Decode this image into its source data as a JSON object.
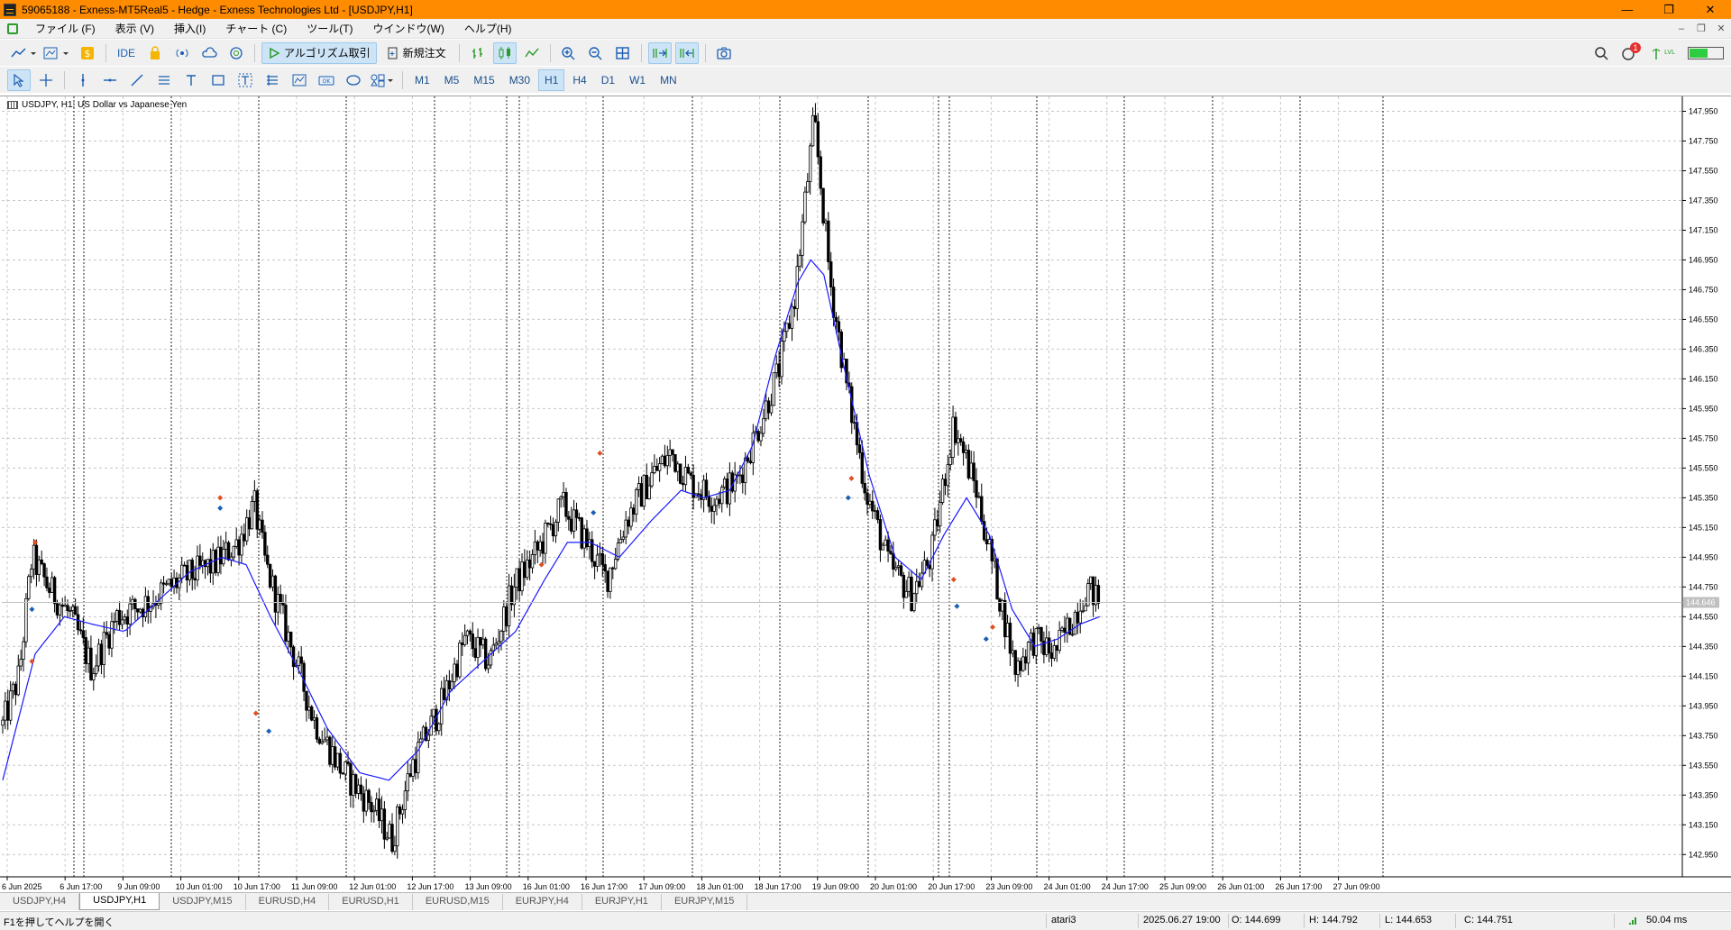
{
  "window": {
    "title": "59065188 - Exness-MT5Real5 - Hedge - Exness Technologies Ltd - [USDJPY,H1]"
  },
  "menu": [
    {
      "label": "ファイル (F)"
    },
    {
      "label": "表示 (V)"
    },
    {
      "label": "挿入(I)"
    },
    {
      "label": "チャート (C)"
    },
    {
      "label": "ツール(T)"
    },
    {
      "label": "ウインドウ(W)"
    },
    {
      "label": "ヘルプ(H)"
    }
  ],
  "toolbar": {
    "ide_label": "IDE",
    "algo_label": "アルゴリズム取引",
    "neworder_label": "新規注文",
    "notification_count": "1",
    "signal_label": "LVL"
  },
  "timeframes": [
    "M1",
    "M5",
    "M15",
    "M30",
    "H1",
    "H4",
    "D1",
    "W1",
    "MN"
  ],
  "active_timeframe": "H1",
  "chart": {
    "symbol_label": "USDJPY, H1:  US Dollar vs Japanese Yen",
    "current_price_label": "144.646"
  },
  "chart_data": {
    "type": "candlestick",
    "symbol": "USDJPY",
    "timeframe": "H1",
    "ylim": [
      142.8,
      148.05
    ],
    "yticks": [
      "147.950",
      "147.750",
      "147.550",
      "147.350",
      "147.150",
      "146.950",
      "146.750",
      "146.550",
      "146.350",
      "146.150",
      "145.950",
      "145.750",
      "145.550",
      "145.350",
      "145.150",
      "144.950",
      "144.750",
      "144.550",
      "144.350",
      "144.150",
      "143.950",
      "143.750",
      "143.550",
      "143.350",
      "143.150",
      "142.950"
    ],
    "xticks": [
      "6 Jun 2025",
      "6 Jun 17:00",
      "9 Jun 09:00",
      "10 Jun 01:00",
      "10 Jun 17:00",
      "11 Jun 09:00",
      "12 Jun 01:00",
      "12 Jun 17:00",
      "13 Jun 09:00",
      "16 Jun 01:00",
      "16 Jun 17:00",
      "17 Jun 09:00",
      "18 Jun 01:00",
      "18 Jun 17:00",
      "19 Jun 09:00",
      "20 Jun 01:00",
      "20 Jun 17:00",
      "23 Jun 09:00",
      "24 Jun 01:00",
      "24 Jun 17:00",
      "25 Jun 09:00",
      "26 Jun 01:00",
      "26 Jun 17:00",
      "27 Jun 09:00"
    ],
    "close_path": [
      [
        0,
        143.82
      ],
      [
        10,
        144.15
      ],
      [
        18,
        144.95
      ],
      [
        28,
        144.75
      ],
      [
        42,
        144.55
      ],
      [
        55,
        144.2
      ],
      [
        70,
        144.55
      ],
      [
        90,
        144.65
      ],
      [
        110,
        144.8
      ],
      [
        130,
        144.9
      ],
      [
        145,
        145.05
      ],
      [
        155,
        145.3
      ],
      [
        162,
        144.9
      ],
      [
        172,
        144.55
      ],
      [
        182,
        144.2
      ],
      [
        192,
        143.85
      ],
      [
        210,
        143.5
      ],
      [
        226,
        143.3
      ],
      [
        240,
        143.05
      ],
      [
        252,
        143.55
      ],
      [
        270,
        143.95
      ],
      [
        285,
        144.4
      ],
      [
        300,
        144.25
      ],
      [
        315,
        144.75
      ],
      [
        330,
        145.0
      ],
      [
        345,
        145.3
      ],
      [
        360,
        145.05
      ],
      [
        372,
        144.8
      ],
      [
        384,
        145.2
      ],
      [
        400,
        145.5
      ],
      [
        412,
        145.65
      ],
      [
        424,
        145.45
      ],
      [
        438,
        145.35
      ],
      [
        452,
        145.45
      ],
      [
        465,
        145.8
      ],
      [
        478,
        146.2
      ],
      [
        488,
        146.7
      ],
      [
        500,
        147.9
      ],
      [
        510,
        146.8
      ],
      [
        520,
        146.1
      ],
      [
        532,
        145.4
      ],
      [
        546,
        144.9
      ],
      [
        560,
        144.7
      ],
      [
        572,
        144.95
      ],
      [
        586,
        145.85
      ],
      [
        600,
        145.4
      ],
      [
        612,
        144.8
      ],
      [
        624,
        144.2
      ],
      [
        635,
        144.4
      ],
      [
        648,
        144.3
      ],
      [
        660,
        144.55
      ],
      [
        668,
        144.75
      ],
      [
        676,
        144.65
      ]
    ],
    "ma_path": [
      [
        0,
        143.45
      ],
      [
        20,
        144.3
      ],
      [
        38,
        144.55
      ],
      [
        55,
        144.5
      ],
      [
        75,
        144.45
      ],
      [
        95,
        144.65
      ],
      [
        115,
        144.85
      ],
      [
        135,
        144.95
      ],
      [
        150,
        144.9
      ],
      [
        165,
        144.55
      ],
      [
        182,
        144.2
      ],
      [
        200,
        143.8
      ],
      [
        220,
        143.5
      ],
      [
        238,
        143.45
      ],
      [
        256,
        143.65
      ],
      [
        276,
        144.05
      ],
      [
        296,
        144.25
      ],
      [
        316,
        144.45
      ],
      [
        334,
        144.8
      ],
      [
        348,
        145.05
      ],
      [
        362,
        145.05
      ],
      [
        380,
        144.95
      ],
      [
        400,
        145.2
      ],
      [
        418,
        145.4
      ],
      [
        432,
        145.35
      ],
      [
        448,
        145.4
      ],
      [
        462,
        145.7
      ],
      [
        476,
        146.3
      ],
      [
        490,
        146.8
      ],
      [
        498,
        146.95
      ],
      [
        506,
        146.85
      ],
      [
        518,
        146.25
      ],
      [
        534,
        145.5
      ],
      [
        550,
        144.95
      ],
      [
        566,
        144.8
      ],
      [
        580,
        145.1
      ],
      [
        594,
        145.35
      ],
      [
        608,
        145.1
      ],
      [
        622,
        144.6
      ],
      [
        636,
        144.35
      ],
      [
        650,
        144.4
      ],
      [
        664,
        144.5
      ],
      [
        676,
        144.55
      ]
    ]
  },
  "tabs": [
    {
      "label": "USDJPY,H4"
    },
    {
      "label": "USDJPY,H1"
    },
    {
      "label": "USDJPY,M15"
    },
    {
      "label": "EURUSD,H4"
    },
    {
      "label": "EURUSD,H1"
    },
    {
      "label": "EURUSD,M15"
    },
    {
      "label": "EURJPY,H4"
    },
    {
      "label": "EURJPY,H1"
    },
    {
      "label": "EURJPY,M15"
    }
  ],
  "active_tab": "USDJPY,H1",
  "status": {
    "help": "F1を押してヘルプを開く",
    "profile": "atari3",
    "datetime": "2025.06.27 19:00",
    "open": "O: 144.699",
    "high": "H: 144.792",
    "low": "L: 144.653",
    "close": "C: 144.751",
    "ping": "50.04 ms"
  },
  "colors": {
    "titlebar": "#ff8c00",
    "ma_line": "#1a1aff",
    "candle": "#000000",
    "accent": "#1a5fb4"
  }
}
